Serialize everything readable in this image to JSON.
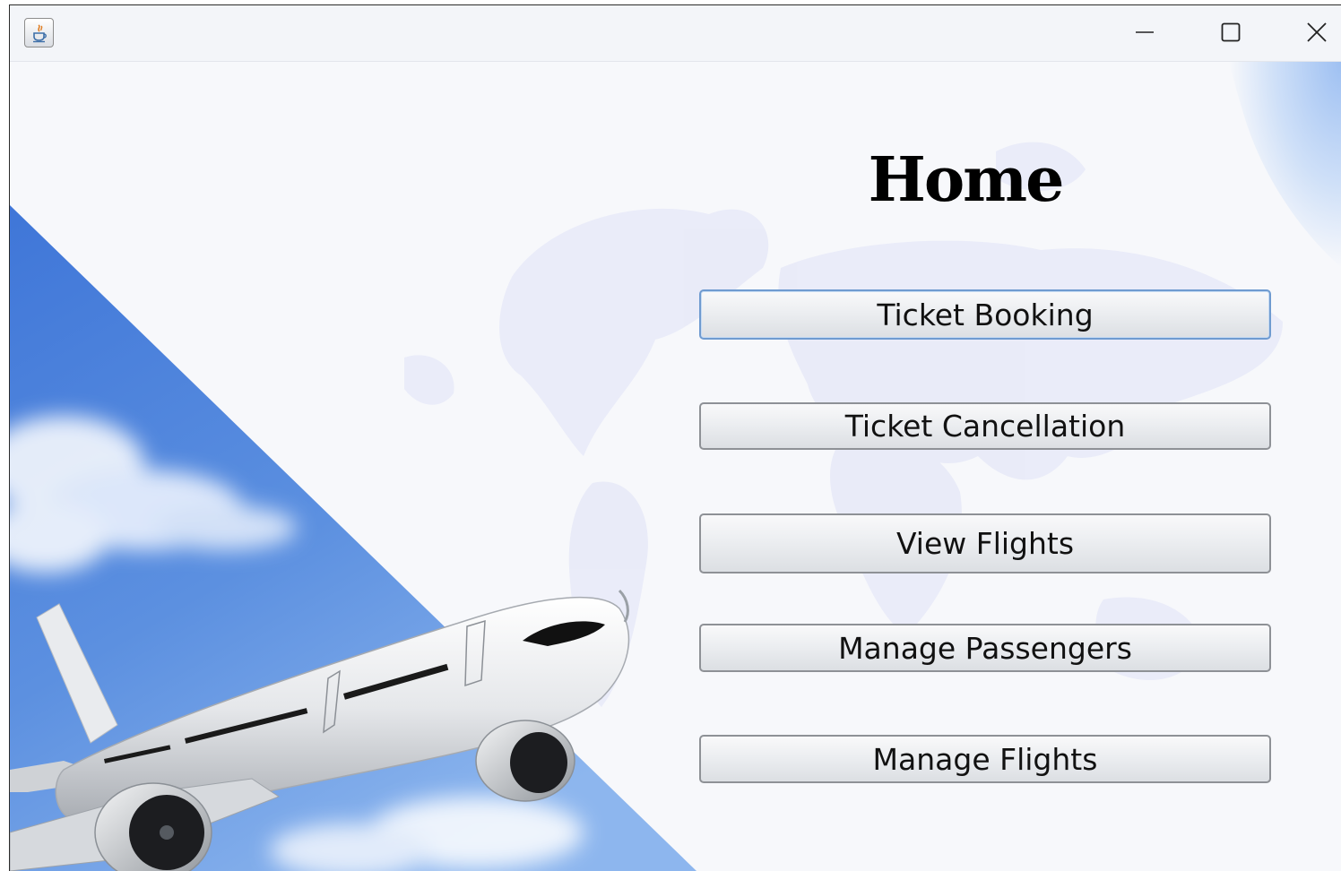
{
  "window": {
    "icon": "java-cup-icon",
    "controls": [
      "minimize-icon",
      "maximize-icon",
      "close-icon"
    ]
  },
  "page": {
    "title": "Home"
  },
  "menu": {
    "buttons": [
      {
        "label": "Ticket Booking",
        "focused": true
      },
      {
        "label": "Ticket Cancellation",
        "focused": false
      },
      {
        "label": "View Flights",
        "focused": false
      },
      {
        "label": "Manage Passengers",
        "focused": false
      },
      {
        "label": "Manage Flights",
        "focused": false
      }
    ]
  },
  "colors": {
    "sky": "#4d83dc",
    "focus_border": "#6f9bd0",
    "map_tint": "#e6e8f8"
  }
}
